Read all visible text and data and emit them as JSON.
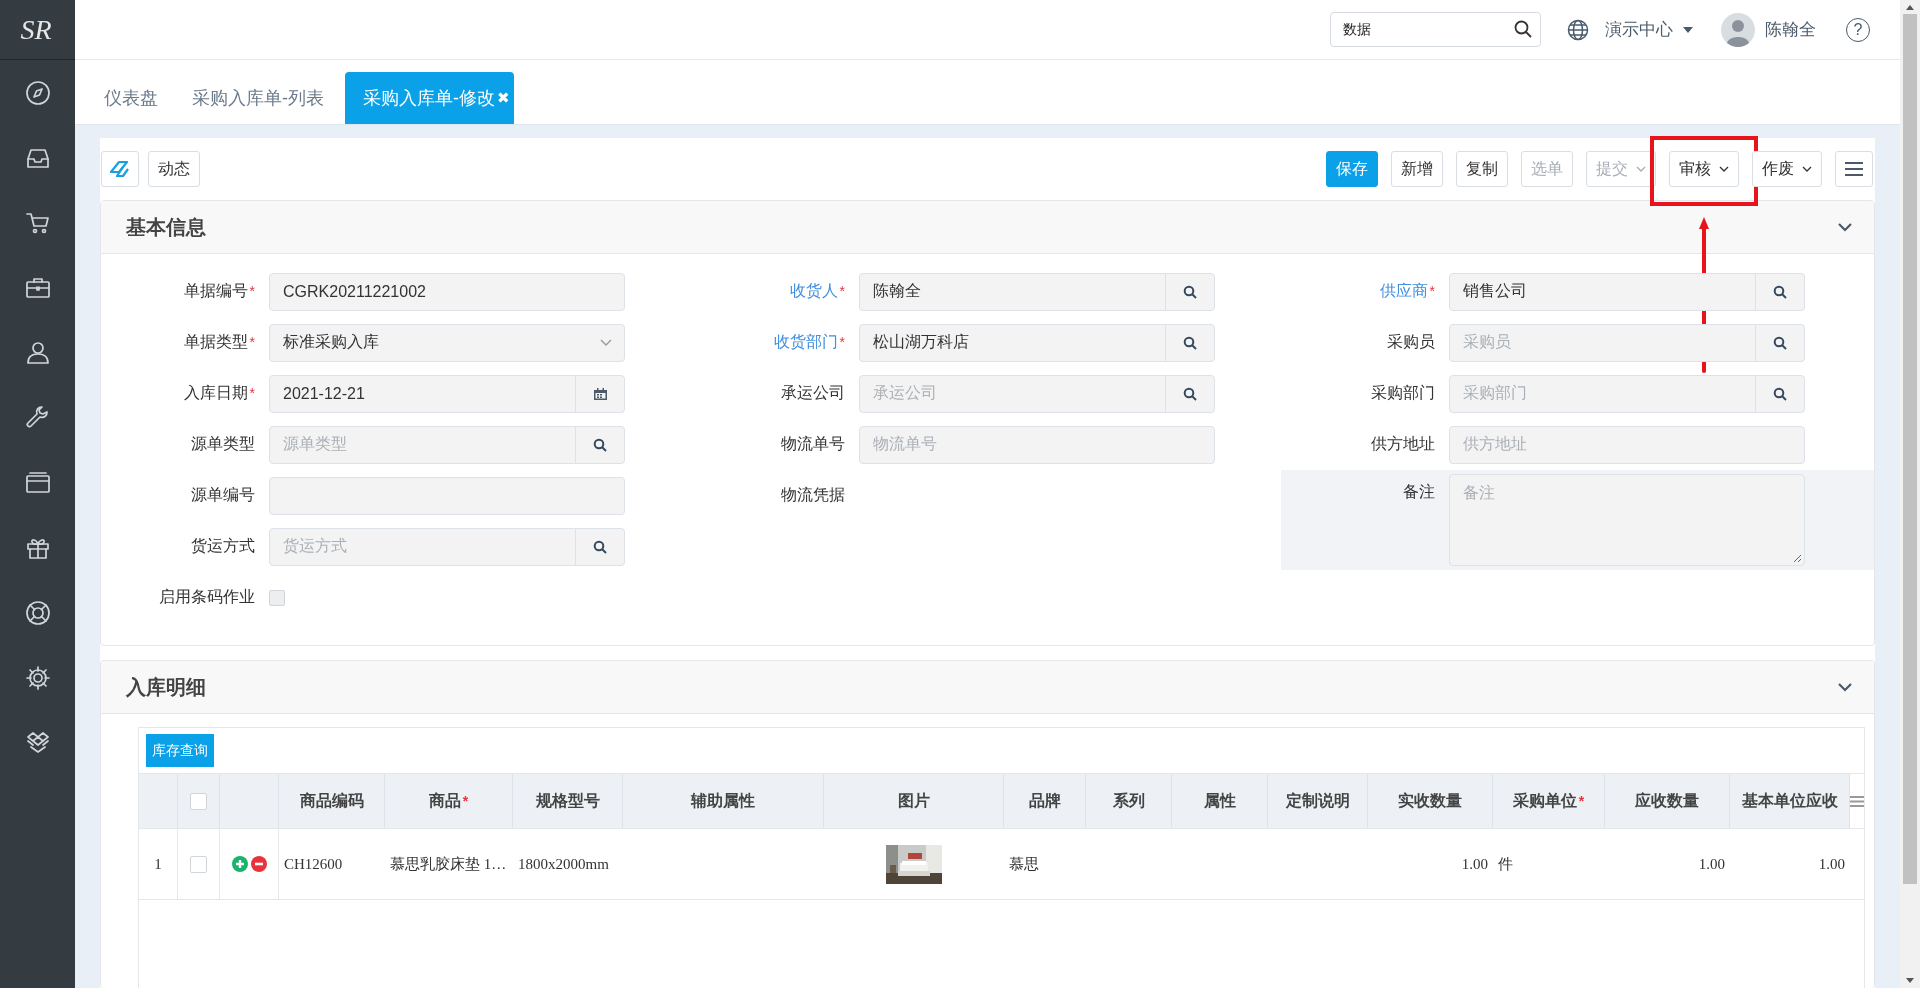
{
  "brand": {
    "logo": "SR"
  },
  "header": {
    "search": {
      "value": "数据"
    },
    "org": "演示中心",
    "user": "陈翰全",
    "help": "?"
  },
  "tabs": [
    {
      "label": "仪表盘",
      "selected": false
    },
    {
      "label": "采购入库单-列表",
      "selected": false
    },
    {
      "label": "采购入库单-修改",
      "selected": true,
      "close": "✖"
    }
  ],
  "toolbar": {
    "left_buttons": [
      {
        "kind": "icon"
      },
      {
        "kind": "text",
        "label": "动态"
      }
    ],
    "right_buttons": [
      {
        "label": "保存",
        "primary": true,
        "disabled": false,
        "dropdown": false,
        "highlighted": false
      },
      {
        "label": "新增",
        "primary": false,
        "disabled": false,
        "dropdown": false,
        "highlighted": false
      },
      {
        "label": "复制",
        "primary": false,
        "disabled": false,
        "dropdown": false,
        "highlighted": false
      },
      {
        "label": "选单",
        "primary": false,
        "disabled": true,
        "dropdown": false,
        "highlighted": false
      },
      {
        "label": "提交",
        "primary": false,
        "disabled": true,
        "dropdown": true,
        "highlighted": false
      },
      {
        "label": "审核",
        "primary": false,
        "disabled": false,
        "dropdown": true,
        "highlighted": true
      },
      {
        "label": "作废",
        "primary": false,
        "disabled": false,
        "dropdown": true,
        "highlighted": false
      }
    ]
  },
  "basic_info": {
    "title": "基本信息",
    "expanded": true,
    "columns": [
      [
        {
          "label": "单据编号",
          "required_mark": "*",
          "linked": false,
          "kind": "text",
          "value": "CGRK20211221002",
          "hovered": false
        },
        {
          "label": "单据类型",
          "required_mark": "*",
          "linked": false,
          "kind": "select",
          "value": "标准采购入库",
          "hovered": false
        },
        {
          "label": "入库日期",
          "required_mark": "*",
          "linked": false,
          "kind": "date",
          "value": "2021-12-21",
          "hovered": false
        },
        {
          "label": "源单类型",
          "linked": false,
          "kind": "lookup",
          "placeholder": "源单类型",
          "hovered": false
        },
        {
          "label": "源单编号",
          "linked": false,
          "kind": "text",
          "hovered": false
        },
        {
          "label": "货运方式",
          "linked": false,
          "kind": "lookup",
          "placeholder": "货运方式",
          "hovered": false
        },
        {
          "label": "启用条码作业",
          "linked": false,
          "kind": "checkbox",
          "checked": false,
          "hovered": false
        }
      ],
      [
        {
          "label": "收货人",
          "required_mark": "*",
          "linked": true,
          "kind": "lookup",
          "value": "陈翰全",
          "hovered": false
        },
        {
          "label": "收货部门",
          "required_mark": "*",
          "linked": true,
          "kind": "lookup",
          "value": "松山湖万科店",
          "hovered": false
        },
        {
          "label": "承运公司",
          "linked": false,
          "kind": "lookup",
          "placeholder": "承运公司",
          "hovered": false
        },
        {
          "label": "物流单号",
          "linked": false,
          "kind": "text",
          "placeholder": "物流单号",
          "hovered": false
        },
        {
          "label": "物流凭据",
          "linked": false,
          "kind": "static",
          "hovered": false
        }
      ],
      [
        {
          "label": "供应商",
          "required_mark": "*",
          "linked": true,
          "kind": "lookup",
          "value": "销售公司",
          "hovered": false
        },
        {
          "label": "采购员",
          "linked": false,
          "kind": "lookup",
          "placeholder": "采购员",
          "hovered": false
        },
        {
          "label": "采购部门",
          "linked": false,
          "kind": "lookup",
          "placeholder": "采购部门",
          "hovered": false
        },
        {
          "label": "供方地址",
          "linked": false,
          "kind": "text",
          "placeholder": "供方地址",
          "hovered": false
        },
        {
          "label": "备注",
          "linked": false,
          "kind": "textarea",
          "placeholder": "备注",
          "hovered": true
        }
      ]
    ]
  },
  "details": {
    "title": "入库明细",
    "expanded": true,
    "stock_button": "库存查询",
    "columns": [
      {
        "kind": "index"
      },
      {
        "kind": "check",
        "checked": false
      },
      {
        "kind": "actions"
      },
      {
        "kind": "text",
        "label": "商品编码"
      },
      {
        "kind": "text",
        "label": "商品",
        "required_mark": "*"
      },
      {
        "kind": "text",
        "label": "规格型号"
      },
      {
        "kind": "text",
        "label": "辅助属性"
      },
      {
        "kind": "text",
        "label": "图片"
      },
      {
        "kind": "text",
        "label": "品牌"
      },
      {
        "kind": "text",
        "label": "系列"
      },
      {
        "kind": "text",
        "label": "属性"
      },
      {
        "kind": "text",
        "label": "定制说明"
      },
      {
        "kind": "text",
        "label": "实收数量"
      },
      {
        "kind": "text",
        "label": "采购单位",
        "required_mark": "*"
      },
      {
        "kind": "text",
        "label": "应收数量"
      },
      {
        "kind": "text",
        "label": "基本单位应收"
      }
    ],
    "rows": [
      {
        "cells": [
          {
            "kind": "index",
            "text": "1"
          },
          {
            "kind": "check",
            "checked": false
          },
          {
            "kind": "actions"
          },
          {
            "kind": "text",
            "text": "CH12600"
          },
          {
            "kind": "text",
            "text": "慕思乳胶床垫 1…"
          },
          {
            "kind": "text",
            "text": "1800x2000mm"
          },
          {
            "kind": "text",
            "text": ""
          },
          {
            "kind": "picture"
          },
          {
            "kind": "text",
            "text": "慕思"
          },
          {
            "kind": "text",
            "text": ""
          },
          {
            "kind": "text",
            "text": ""
          },
          {
            "kind": "text",
            "text": ""
          },
          {
            "kind": "number",
            "text": "1.00"
          },
          {
            "kind": "text",
            "text": "件"
          },
          {
            "kind": "number",
            "text": "1.00"
          },
          {
            "kind": "number",
            "text": "1.00"
          }
        ]
      }
    ]
  }
}
